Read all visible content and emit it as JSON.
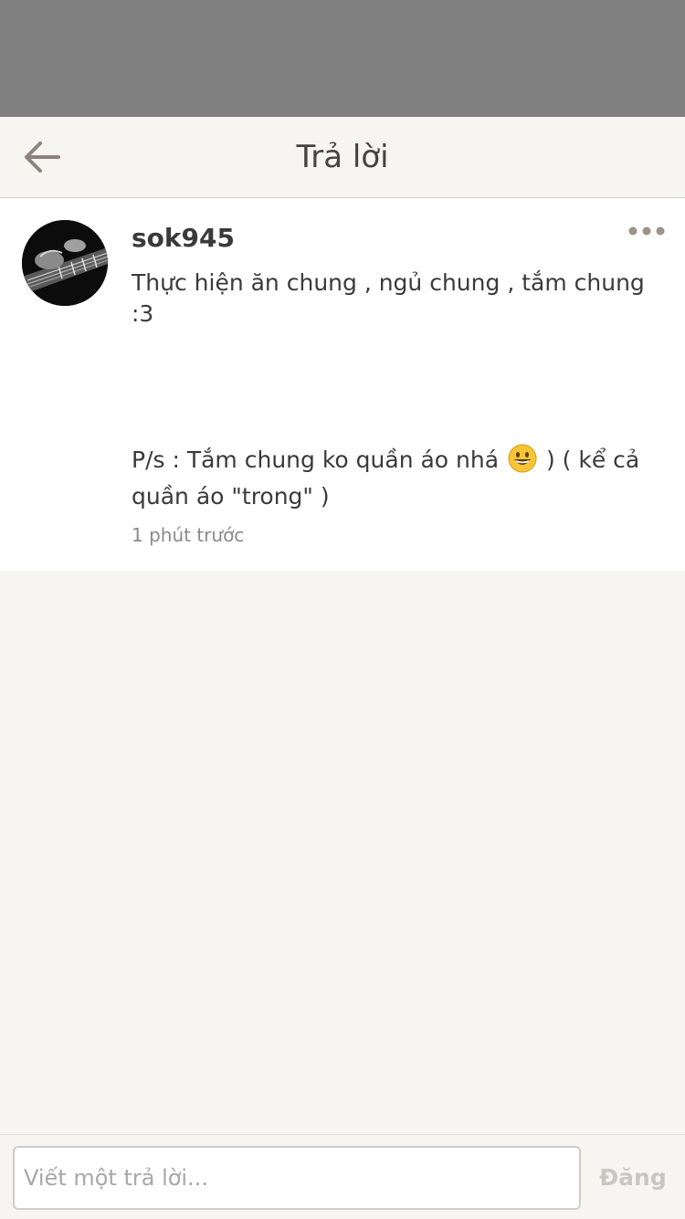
{
  "header": {
    "title": "Trả lời",
    "back_icon": "back-arrow-icon"
  },
  "post": {
    "username": "sok945",
    "text": "Thực hiện ăn chung , ngủ chung , tắm chung :3",
    "ps_before_emoji": "P/s : Tắm chung ko quần áo nhá",
    "emoji_icon": "grinning-face-emoji",
    "ps_after_emoji": ") ( kể cả quần áo \"trong\" )",
    "timestamp": "1 phút trước",
    "more_icon": "more-dots-icon"
  },
  "reply": {
    "placeholder": "Viết một trả lời...",
    "submit_label": "Đăng"
  },
  "colors": {
    "status_area": "#808080",
    "background": "#f6f5f1",
    "card": "#ffffff",
    "disabled_text": "#c9c7c2"
  }
}
